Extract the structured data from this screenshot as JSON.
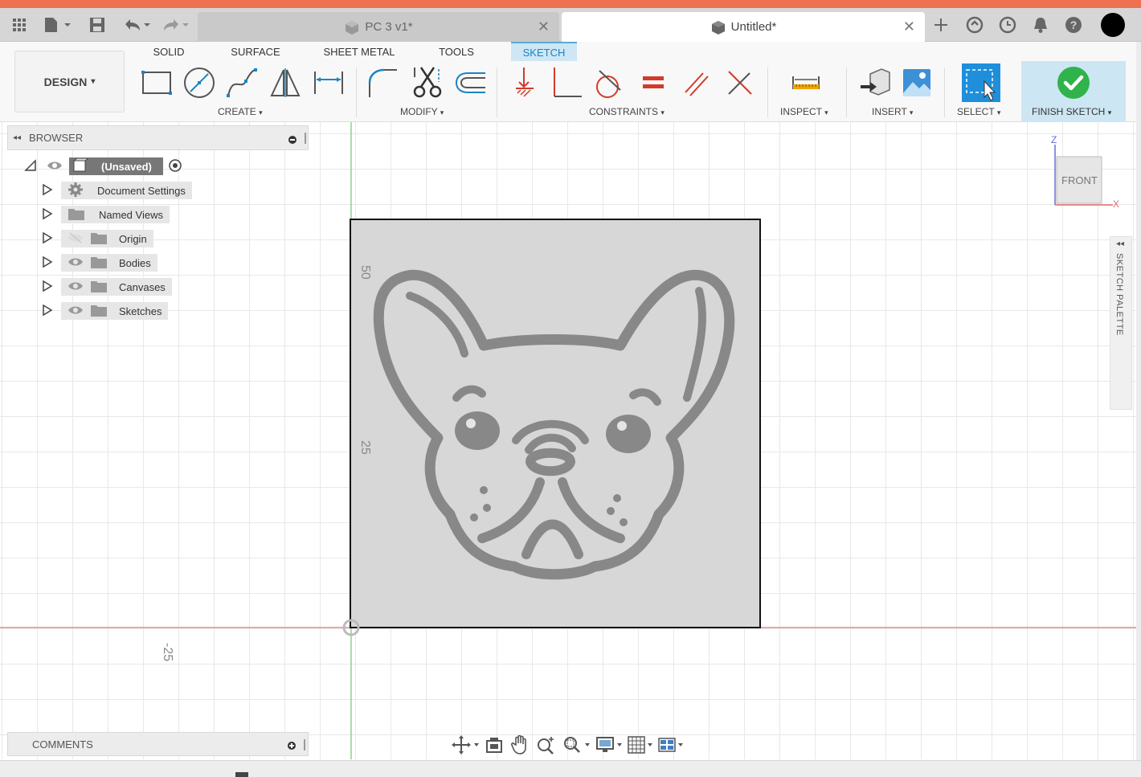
{
  "tabs": {
    "inactive_title": "PC 3 v1*",
    "active_title": "Untitled*",
    "close_glyph": "✕"
  },
  "toolbar": {
    "design_label": "DESIGN",
    "workspace_tabs": [
      "SOLID",
      "SURFACE",
      "SHEET METAL",
      "TOOLS",
      "SKETCH"
    ],
    "active_tab": "SKETCH",
    "groups": {
      "create": "CREATE",
      "modify": "MODIFY",
      "constraints": "CONSTRAINTS",
      "inspect": "INSPECT",
      "insert": "INSERT",
      "select": "SELECT",
      "finish": "FINISH SKETCH"
    },
    "dropdown_glyph": "▾"
  },
  "browser": {
    "title": "BROWSER",
    "root_label": "(Unsaved)",
    "items": [
      {
        "label": "Document Settings",
        "icon": "gear-icon"
      },
      {
        "label": "Named Views",
        "icon": "folder-icon"
      },
      {
        "label": "Origin",
        "icon": "folder-icon"
      },
      {
        "label": "Bodies",
        "icon": "folder-icon"
      },
      {
        "label": "Canvases",
        "icon": "folder-icon"
      },
      {
        "label": "Sketches",
        "icon": "folder-icon"
      }
    ]
  },
  "comments": {
    "title": "COMMENTS"
  },
  "canvas": {
    "ruler_labels": [
      "50",
      "25",
      "-25"
    ],
    "viewcube_face": "FRONT",
    "axis_z": "Z",
    "axis_x": "X",
    "palette_title": "SKETCH PALETTE"
  },
  "colors": {
    "accent": "#1b84c5",
    "title_strip": "#ee7152",
    "finish_green": "#2fb34a",
    "sketch_tab_bg": "#cfe6f4",
    "x_axis": "#e88a8a",
    "y_axis": "#8fd08f"
  }
}
